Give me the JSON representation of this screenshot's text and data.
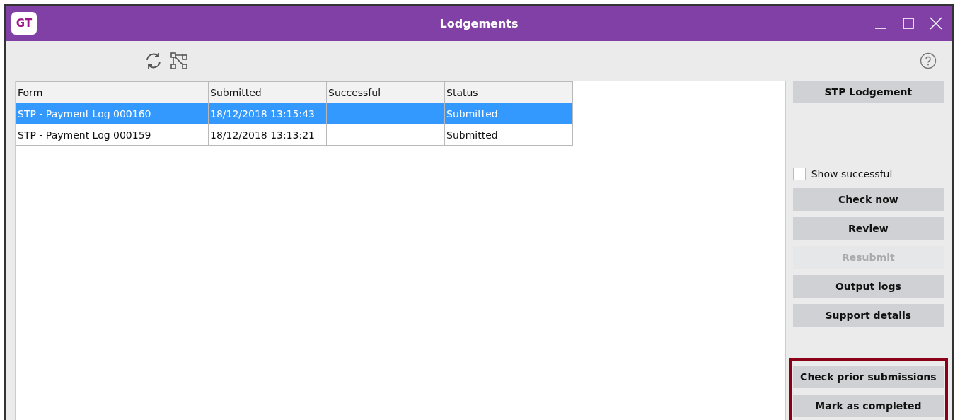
{
  "window": {
    "title": "Lodgements",
    "logo": "GT"
  },
  "table": {
    "columns": [
      "Form",
      "Submitted",
      "Successful",
      "Status"
    ],
    "rows": [
      {
        "cells": [
          "STP - Payment Log 000160",
          "18/12/2018 13:15:43",
          "",
          "Submitted"
        ],
        "selected": true
      },
      {
        "cells": [
          "STP - Payment Log 000159",
          "18/12/2018 13:13:21",
          "",
          "Submitted"
        ],
        "selected": false
      }
    ]
  },
  "top_button": {
    "label": "STP Lodgement",
    "disabled": false
  },
  "show_successful": {
    "label": "Show successful",
    "checked": false
  },
  "buttons": [
    {
      "label": "Check now",
      "disabled": false
    },
    {
      "label": "Review",
      "disabled": false
    },
    {
      "label": "Resubmit",
      "disabled": true
    },
    {
      "label": "Output logs",
      "disabled": false
    },
    {
      "label": "Support details",
      "disabled": false
    }
  ],
  "highlighted_buttons": [
    {
      "label": "Check prior submissions",
      "disabled": false
    },
    {
      "label": "Mark as completed",
      "disabled": false
    }
  ]
}
